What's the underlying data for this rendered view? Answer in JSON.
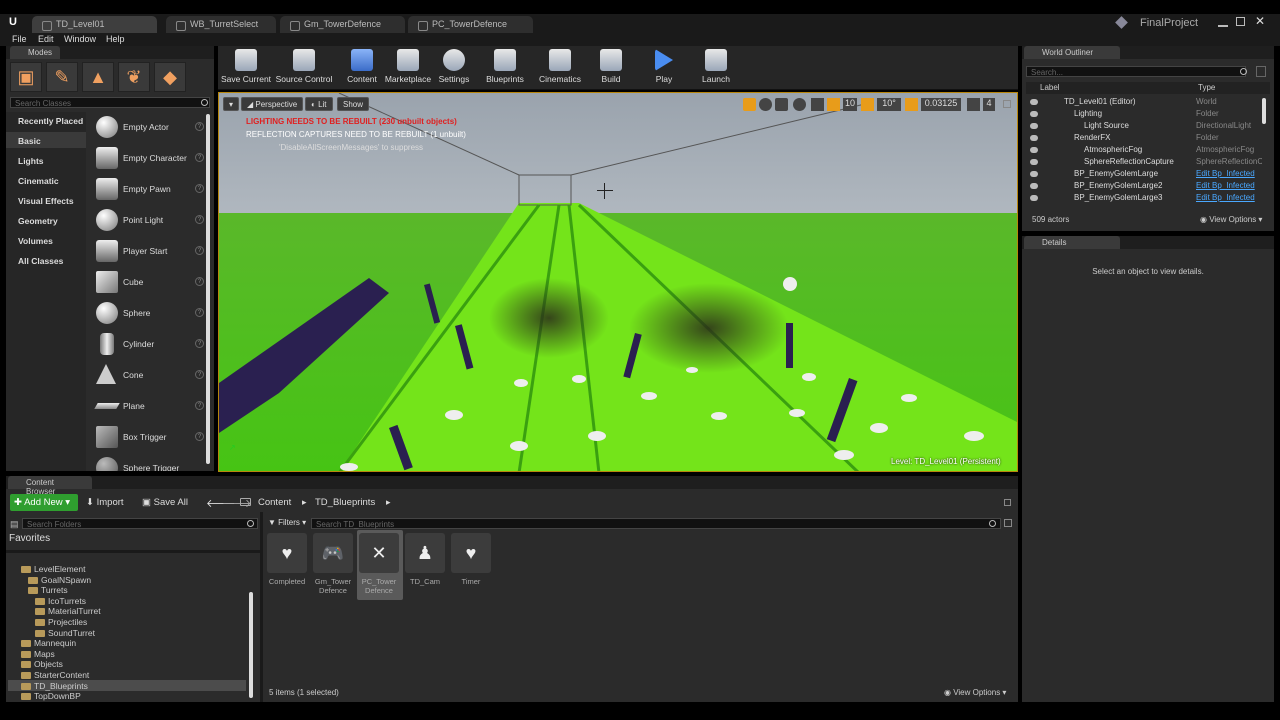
{
  "window": {
    "app_logo": "U",
    "project": "FinalProject",
    "tabs": [
      "TD_Level01",
      "WB_TurretSelect",
      "Gm_TowerDefence",
      "PC_TowerDefence"
    ]
  },
  "menu": [
    "File",
    "Edit",
    "Window",
    "Help"
  ],
  "modes": {
    "title": "Modes",
    "search_placeholder": "Search Classes",
    "categories": [
      "Recently Placed",
      "Basic",
      "Lights",
      "Cinematic",
      "Visual Effects",
      "Geometry",
      "Volumes",
      "All Classes"
    ],
    "items": [
      "Empty Actor",
      "Empty Character",
      "Empty Pawn",
      "Point Light",
      "Player Start",
      "Cube",
      "Sphere",
      "Cylinder",
      "Cone",
      "Plane",
      "Box Trigger",
      "Sphere Trigger"
    ]
  },
  "toolbar": [
    "Save Current",
    "Source Control",
    "Content",
    "Marketplace",
    "Settings",
    "Blueprints",
    "Cinematics",
    "Build",
    "Play",
    "Launch"
  ],
  "viewport": {
    "perspective": "Perspective",
    "lit": "Lit",
    "show": "Show",
    "warning1": "LIGHTING NEEDS TO BE REBUILT (230 unbuilt objects)",
    "warning2": "REFLECTION CAPTURES NEED TO BE REBUILT (1 unbuilt)",
    "warning3": "'DisableAllScreenMessages' to suppress",
    "grid_snap": "10",
    "angle_snap": "10°",
    "scale_snap": "0.03125",
    "camera_speed": "4",
    "level": "Level:  TD_Level01 (Persistent)"
  },
  "outliner": {
    "title": "World Outliner",
    "search_placeholder": "Search...",
    "col_label": "Label",
    "col_type": "Type",
    "rows": [
      {
        "name": "TD_Level01 (Editor)",
        "type": "World",
        "indent": 0,
        "link": false
      },
      {
        "name": "Lighting",
        "type": "Folder",
        "indent": 1,
        "link": false
      },
      {
        "name": "Light Source",
        "type": "DirectionalLight",
        "indent": 2,
        "link": false
      },
      {
        "name": "RenderFX",
        "type": "Folder",
        "indent": 1,
        "link": false
      },
      {
        "name": "AtmosphericFog",
        "type": "AtmosphericFog",
        "indent": 2,
        "link": false
      },
      {
        "name": "SphereReflectionCapture",
        "type": "SphereReflectionC",
        "indent": 2,
        "link": false
      },
      {
        "name": "BP_EnemyGolemLarge",
        "type": "Edit Bp_Infected",
        "indent": 1,
        "link": true
      },
      {
        "name": "BP_EnemyGolemLarge2",
        "type": "Edit Bp_Infected",
        "indent": 1,
        "link": true
      },
      {
        "name": "BP_EnemyGolemLarge3",
        "type": "Edit Bp_Infected",
        "indent": 1,
        "link": true
      }
    ],
    "count": "509 actors",
    "view_options": "View Options"
  },
  "details": {
    "title": "Details",
    "empty": "Select an object to view details."
  },
  "content_browser": {
    "title": "Content Browser",
    "add_new": "Add New",
    "import": "Import",
    "save_all": "Save All",
    "path": [
      "Content",
      "TD_Blueprints"
    ],
    "search_folders": "Search Folders",
    "favorites": "Favorites",
    "filters": "Filters",
    "search_assets": "Search TD_Blueprints",
    "folders": [
      {
        "name": "LevelElement",
        "indent": 1
      },
      {
        "name": "GoalNSpawn",
        "indent": 2
      },
      {
        "name": "Turrets",
        "indent": 2
      },
      {
        "name": "IcoTurrets",
        "indent": 3
      },
      {
        "name": "MaterialTurret",
        "indent": 3
      },
      {
        "name": "Projectiles",
        "indent": 3
      },
      {
        "name": "SoundTurret",
        "indent": 3
      },
      {
        "name": "Mannequin",
        "indent": 1
      },
      {
        "name": "Maps",
        "indent": 1
      },
      {
        "name": "Objects",
        "indent": 1
      },
      {
        "name": "StarterContent",
        "indent": 1
      },
      {
        "name": "TD_Blueprints",
        "indent": 1
      },
      {
        "name": "TopDownBP",
        "indent": 1
      }
    ],
    "assets": [
      {
        "line1": "Completed",
        "line2": ""
      },
      {
        "line1": "Gm_Tower",
        "line2": "Defence"
      },
      {
        "line1": "PC_Tower",
        "line2": "Defence"
      },
      {
        "line1": "TD_Cam",
        "line2": ""
      },
      {
        "line1": "Timer",
        "line2": ""
      }
    ],
    "status": "5 items (1 selected)",
    "view_options": "View Options"
  }
}
